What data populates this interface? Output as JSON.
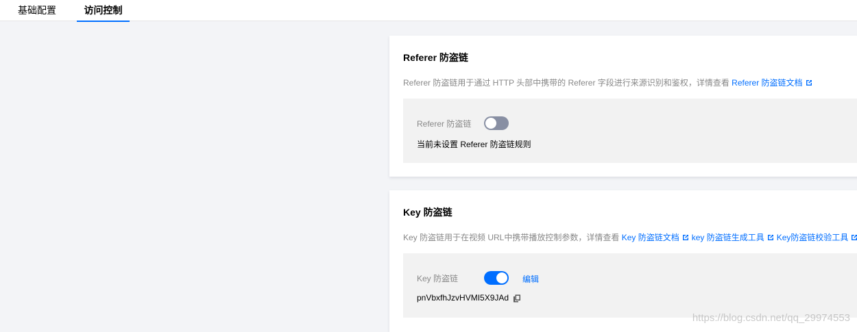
{
  "tabs": [
    {
      "label": "基础配置"
    },
    {
      "label": "访问控制"
    }
  ],
  "referer": {
    "title": "Referer 防盗链",
    "desc": "Referer 防盗链用于通过 HTTP 头部中携带的 Referer 字段进行来源识别和鉴权，详情查看",
    "doc_link": "Referer 防盗链文档",
    "row_label": "Referer 防盗链",
    "enabled": false,
    "status": "当前未设置 Referer 防盗链规则"
  },
  "key": {
    "title": "Key 防盗链",
    "desc": "Key 防盗链用于在视频 URL中携带播放控制参数，详情查看",
    "links": [
      "Key 防盗链文档",
      "key 防盗链生成工具",
      "Key防盗链校验工具"
    ],
    "row_label": "Key 防盗链",
    "enabled": true,
    "edit_label": "编辑",
    "value": "pnVbxfhJzvHVMI5X9JAd"
  },
  "watermark": "https://blog.csdn.net/qq_29974553",
  "colors": {
    "accent": "#006eff",
    "switch_off": "#888fa3",
    "panel": "#f2f2f2"
  },
  "icons": {
    "external": "external-link-icon",
    "copy": "copy-icon"
  }
}
